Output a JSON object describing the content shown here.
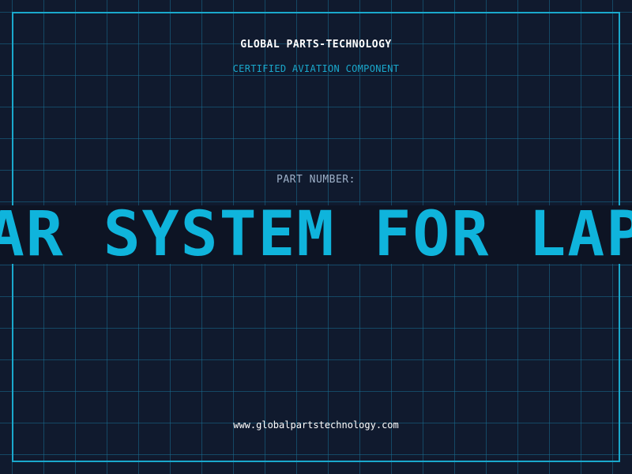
{
  "brand": {
    "name": "GLOBAL PARTS-TECHNOLOGY",
    "tagline": "CERTIFIED AVIATION COMPONENT"
  },
  "part": {
    "label": "PART NUMBER:",
    "value": "RADAR SYSTEM FOR LAPTOP"
  },
  "footer": {
    "url": "www.globalpartstechnology.com"
  },
  "colors": {
    "background": "#101a2e",
    "accent": "#1aa8cc",
    "part_value": "#0fb4dc",
    "band": "#0d1424"
  }
}
